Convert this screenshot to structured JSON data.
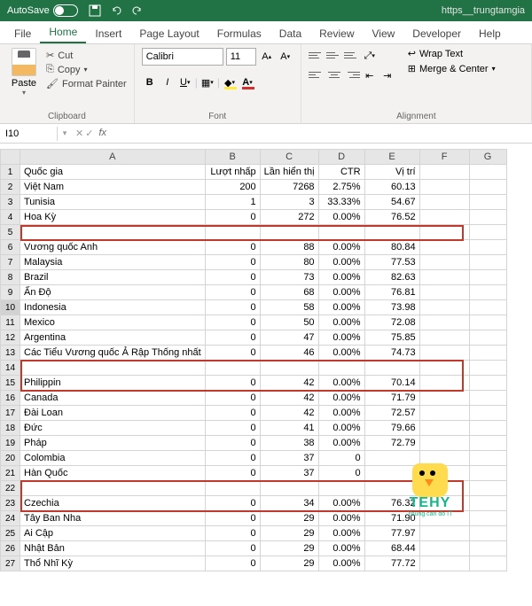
{
  "titlebar": {
    "autosave": "AutoSave",
    "doc": "https__trungtamgia"
  },
  "tabs": [
    "File",
    "Home",
    "Insert",
    "Page Layout",
    "Formulas",
    "Data",
    "Review",
    "View",
    "Developer",
    "Help"
  ],
  "clipboard": {
    "paste": "Paste",
    "cut": "Cut",
    "copy": "Copy",
    "painter": "Format Painter",
    "label": "Clipboard"
  },
  "font": {
    "name": "Calibri",
    "size": "11",
    "label": "Font"
  },
  "alignment": {
    "wrap": "Wrap Text",
    "merge": "Merge & Center",
    "label": "Alignment"
  },
  "namebox": "I10",
  "headers": {
    "row": "",
    "A": "A",
    "B": "B",
    "C": "C",
    "D": "D",
    "E": "E",
    "F": "F",
    "G": "G"
  },
  "rows": [
    {
      "n": "1",
      "A": "Quốc gia",
      "B": "Lượt nhấp",
      "C": "Lần hiển thị",
      "D": "CTR",
      "E": "Vị trí"
    },
    {
      "n": "2",
      "A": "Việt Nam",
      "B": "200",
      "C": "7268",
      "D": "2.75%",
      "E": "60.13"
    },
    {
      "n": "3",
      "A": "Tunisia",
      "B": "1",
      "C": "3",
      "D": "33.33%",
      "E": "54.67"
    },
    {
      "n": "4",
      "A": "Hoa Kỳ",
      "B": "0",
      "C": "272",
      "D": "0.00%",
      "E": "76.52"
    },
    {
      "n": "5",
      "A": "",
      "B": "",
      "C": "",
      "D": "",
      "E": ""
    },
    {
      "n": "6",
      "A": "Vương quốc Anh",
      "B": "0",
      "C": "88",
      "D": "0.00%",
      "E": "80.84"
    },
    {
      "n": "7",
      "A": "Malaysia",
      "B": "0",
      "C": "80",
      "D": "0.00%",
      "E": "77.53"
    },
    {
      "n": "8",
      "A": "Brazil",
      "B": "0",
      "C": "73",
      "D": "0.00%",
      "E": "82.63"
    },
    {
      "n": "9",
      "A": "Ấn Độ",
      "B": "0",
      "C": "68",
      "D": "0.00%",
      "E": "76.81"
    },
    {
      "n": "10",
      "A": "Indonesia",
      "B": "0",
      "C": "58",
      "D": "0.00%",
      "E": "73.98"
    },
    {
      "n": "11",
      "A": "Mexico",
      "B": "0",
      "C": "50",
      "D": "0.00%",
      "E": "72.08"
    },
    {
      "n": "12",
      "A": "Argentina",
      "B": "0",
      "C": "47",
      "D": "0.00%",
      "E": "75.85"
    },
    {
      "n": "13",
      "A": "Các Tiểu Vương quốc Ả Rập Thống nhất",
      "B": "0",
      "C": "46",
      "D": "0.00%",
      "E": "74.73"
    },
    {
      "n": "14",
      "A": "",
      "B": "",
      "C": "",
      "D": "",
      "E": ""
    },
    {
      "n": "15",
      "A": "Philippin",
      "B": "0",
      "C": "42",
      "D": "0.00%",
      "E": "70.14"
    },
    {
      "n": "16",
      "A": "Canada",
      "B": "0",
      "C": "42",
      "D": "0.00%",
      "E": "71.79"
    },
    {
      "n": "17",
      "A": "Đài Loan",
      "B": "0",
      "C": "42",
      "D": "0.00%",
      "E": "72.57"
    },
    {
      "n": "18",
      "A": "Đức",
      "B": "0",
      "C": "41",
      "D": "0.00%",
      "E": "79.66"
    },
    {
      "n": "19",
      "A": "Pháp",
      "B": "0",
      "C": "38",
      "D": "0.00%",
      "E": "72.79"
    },
    {
      "n": "20",
      "A": "Colombia",
      "B": "0",
      "C": "37",
      "D": "0",
      "E": ""
    },
    {
      "n": "21",
      "A": "Hàn Quốc",
      "B": "0",
      "C": "37",
      "D": "0",
      "E": ""
    },
    {
      "n": "22",
      "A": "",
      "B": "",
      "C": "",
      "D": "",
      "E": ""
    },
    {
      "n": "23",
      "A": "Czechia",
      "B": "0",
      "C": "34",
      "D": "0.00%",
      "E": "76.32"
    },
    {
      "n": "24",
      "A": "Tây Ban Nha",
      "B": "0",
      "C": "29",
      "D": "0.00%",
      "E": "71.90"
    },
    {
      "n": "25",
      "A": "Ai Cập",
      "B": "0",
      "C": "29",
      "D": "0.00%",
      "E": "77.97"
    },
    {
      "n": "26",
      "A": "Nhật Bản",
      "B": "0",
      "C": "29",
      "D": "0.00%",
      "E": "68.44"
    },
    {
      "n": "27",
      "A": "Thổ Nhĩ Kỳ",
      "B": "0",
      "C": "29",
      "D": "0.00%",
      "E": "77.72"
    }
  ],
  "mascot": {
    "brand": "TEHY",
    "tagline": "Young can do IT"
  }
}
